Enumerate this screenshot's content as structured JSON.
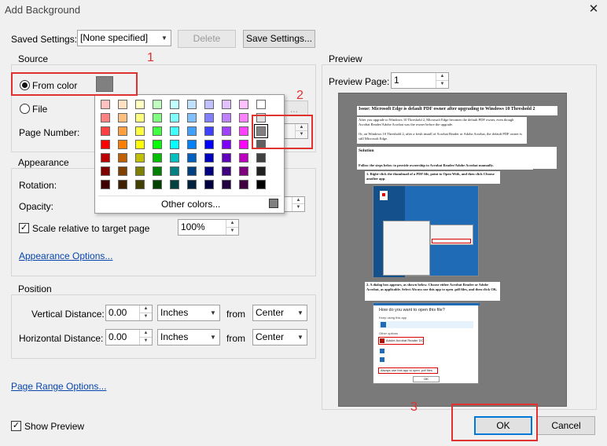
{
  "window": {
    "title": "Add Background",
    "close_glyph": "✕"
  },
  "saved_settings": {
    "label": "Saved Settings:",
    "value": "[None specified]",
    "delete_label": "Delete",
    "save_label": "Save Settings..."
  },
  "source": {
    "label": "Source",
    "from_color_label": "From color",
    "file_label": "File",
    "page_number_label": "Page Number:",
    "selected_color": "#808080",
    "other_colors_label": "Other colors...",
    "grid_colors": [
      [
        "#ffc0c0",
        "#ffe0c0",
        "#ffffc0",
        "#c0ffc0",
        "#c0ffff",
        "#c0e0ff",
        "#c0c0ff",
        "#e0c0ff",
        "#ffc0ff",
        "#ffffff"
      ],
      [
        "#ff8080",
        "#ffc080",
        "#ffff80",
        "#80ff80",
        "#80ffff",
        "#80c0ff",
        "#8080ff",
        "#c080ff",
        "#ff80ff",
        "#e0e0e0"
      ],
      [
        "#ff4040",
        "#ffa040",
        "#ffff40",
        "#40ff40",
        "#40ffff",
        "#40a0ff",
        "#4040ff",
        "#a040ff",
        "#ff40ff",
        "#808080"
      ],
      [
        "#ff0000",
        "#ff8000",
        "#ffff00",
        "#00ff00",
        "#00ffff",
        "#0080ff",
        "#0000ff",
        "#8000ff",
        "#ff00ff",
        "#606060"
      ],
      [
        "#c00000",
        "#c06000",
        "#c0c000",
        "#00c000",
        "#00c0c0",
        "#0060c0",
        "#0000c0",
        "#6000c0",
        "#c000c0",
        "#404040"
      ],
      [
        "#800000",
        "#804000",
        "#808000",
        "#008000",
        "#008080",
        "#004080",
        "#000080",
        "#400080",
        "#800080",
        "#202020"
      ],
      [
        "#400000",
        "#402000",
        "#404000",
        "#004000",
        "#004040",
        "#002040",
        "#000040",
        "#200040",
        "#400040",
        "#000000"
      ]
    ]
  },
  "appearance": {
    "label": "Appearance",
    "rotation_label": "Rotation:",
    "opacity_label": "Opacity:",
    "scale_label": "Scale relative to target page",
    "scale_value": "100%",
    "options_link": "Appearance Options..."
  },
  "position": {
    "label": "Position",
    "vertical_label": "Vertical Distance:",
    "vertical_value": "0.00",
    "vertical_unit": "Inches",
    "vertical_from": "from",
    "vertical_anchor": "Center",
    "horizontal_label": "Horizontal Distance:",
    "horizontal_value": "0.00",
    "horizontal_unit": "Inches",
    "horizontal_from": "from",
    "horizontal_anchor": "Center"
  },
  "page_range_link": "Page Range Options...",
  "show_preview_label": "Show Preview",
  "preview": {
    "label": "Preview",
    "page_label": "Preview Page:",
    "page_value": "1",
    "doc": {
      "heading": "Issue: Microsoft Edge is default PDF owner after upgrading to Windows 10 Threshold 2",
      "para1": "After you upgrade to Windows 10 Threshold 2, Microsoft Edge becomes the default PDF owner, even though Acrobat Reader/Adobe Acrobat was the owner before the upgrade.",
      "para2": "Or, on Windows 10 Threshold 2, after a fresh install of Acrobat Reader or Adobe Acrobat, the default PDF owner is still Microsoft Edge.",
      "solution": "Solution",
      "steps_intro": "Follow the steps below to provide ownership to Acrobat Reader/Adobe Acrobat manually.",
      "step1": "1.   Right-click the thumbnail of a PDF file, point to Open With, and then click Choose another app.",
      "step2": "2.   A dialog box appears, as shown below. Choose either Acrobat Reader or Adobe Acrobat, as applicable. Select Always use this app to open .pdf files, and then click OK.",
      "dialog_title": "How do you want to open this file?",
      "keep_using": "Keep using this app",
      "other_options": "Other options",
      "acrobat_option": "Adobe Acrobat Reader DC",
      "always_use": "Always use this app to open .pdf files",
      "ok": "OK"
    }
  },
  "buttons": {
    "ok": "OK",
    "cancel": "Cancel"
  },
  "annotations": {
    "n1": "1",
    "n2": "2",
    "n3": "3"
  }
}
